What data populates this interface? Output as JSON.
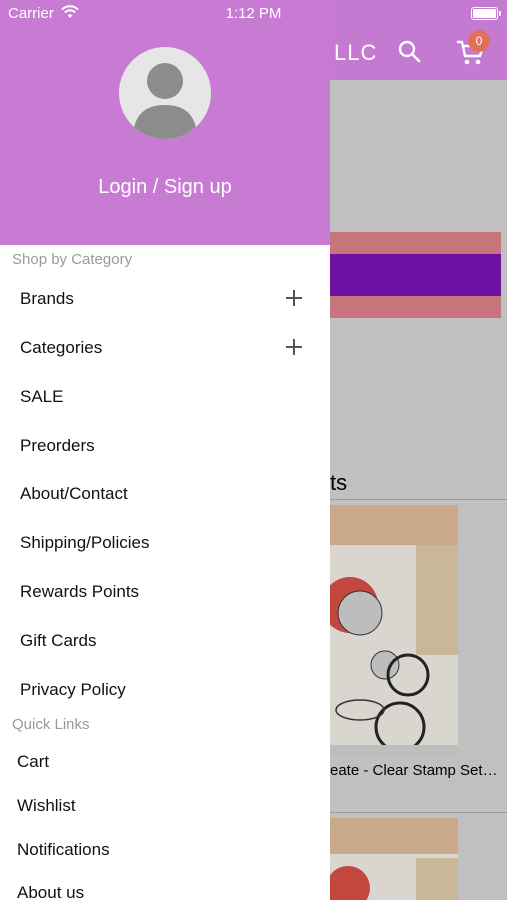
{
  "status_bar": {
    "carrier": "Carrier",
    "time": "1:12 PM"
  },
  "background_app": {
    "title_fragment": "LLC",
    "cart_count": "0",
    "section_title_fragment": "ts",
    "product_title_fragment": "eate - Clear Stamp Set…",
    "header_color": "#c57ad1"
  },
  "drawer": {
    "login_label": "Login / Sign up",
    "shop_section": {
      "label": "Shop by Category",
      "items": [
        {
          "label": "Brands",
          "expandable": true
        },
        {
          "label": "Categories",
          "expandable": true
        },
        {
          "label": "SALE",
          "expandable": false
        },
        {
          "label": "Preorders",
          "expandable": false
        },
        {
          "label": "About/Contact",
          "expandable": false
        },
        {
          "label": "Shipping/Policies",
          "expandable": false
        },
        {
          "label": "Rewards Points",
          "expandable": false
        },
        {
          "label": "Gift Cards",
          "expandable": false
        },
        {
          "label": "Privacy Policy",
          "expandable": false
        }
      ]
    },
    "quick_section": {
      "label": "Quick Links",
      "items": [
        {
          "label": "Cart"
        },
        {
          "label": "Wishlist"
        },
        {
          "label": "Notifications"
        },
        {
          "label": "About us"
        }
      ]
    },
    "accent_color": "#c87bd3"
  }
}
